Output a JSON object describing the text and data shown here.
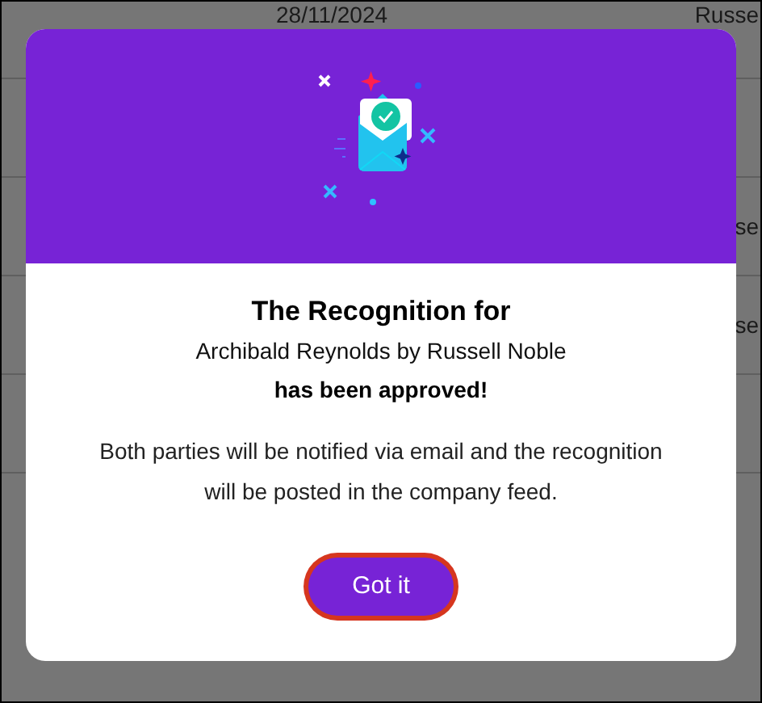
{
  "background_table": {
    "rows": [
      {
        "date": "28/11/2024",
        "name": "Russe"
      },
      {},
      {
        "name": "se"
      },
      {
        "name": "se"
      },
      {}
    ]
  },
  "dialog": {
    "title": "The Recognition for",
    "subtitle": "Archibald Reynolds by Russell Noble",
    "status": "has been approved!",
    "message": "Both parties will be notified via email and the recognition will be posted in the company feed.",
    "button": {
      "label": "Got it",
      "focused": true
    }
  }
}
